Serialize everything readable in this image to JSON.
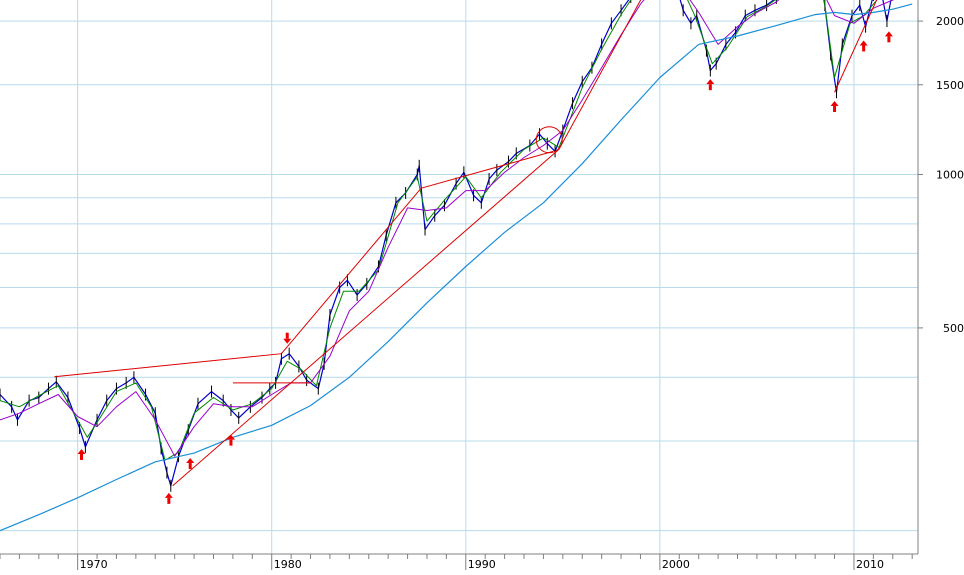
{
  "chart_data": {
    "type": "line",
    "title": "",
    "xlabel": "",
    "ylabel": "",
    "y_scale": "log",
    "ylim": [
      180,
      2200
    ],
    "xlim": [
      1966,
      2013.3
    ],
    "y_ticks": [
      {
        "value": 2000,
        "label": "2000"
      },
      {
        "value": 1500,
        "label": "1500"
      },
      {
        "value": 1000,
        "label": "1000"
      },
      {
        "value": 500,
        "label": "500"
      }
    ],
    "x_ticks": [
      {
        "value": 1970,
        "label": "1970"
      },
      {
        "value": 1980,
        "label": "1980"
      },
      {
        "value": 1990,
        "label": "1990"
      },
      {
        "value": 2000,
        "label": "2000"
      },
      {
        "value": 2010,
        "label": "2010"
      }
    ],
    "grid": true,
    "colors": {
      "price": "#0000cc",
      "fast_ma": "#008800",
      "mid_ma": "#9900cc",
      "slow_ma": "#1a8fd8",
      "trendline": "#dd0000",
      "arrow": "#ee0000",
      "grid": "#b7dcec",
      "axis": "#808080"
    },
    "series": [
      {
        "key": "price",
        "points": [
          [
            1966.0,
            370
          ],
          [
            1966.6,
            350
          ],
          [
            1966.9,
            330
          ],
          [
            1967.5,
            360
          ],
          [
            1968.0,
            365
          ],
          [
            1968.5,
            380
          ],
          [
            1968.9,
            392
          ],
          [
            1969.5,
            365
          ],
          [
            1970.1,
            318
          ],
          [
            1970.4,
            292
          ],
          [
            1971.0,
            330
          ],
          [
            1971.5,
            360
          ],
          [
            1972.0,
            380
          ],
          [
            1972.5,
            390
          ],
          [
            1972.9,
            400
          ],
          [
            1973.5,
            370
          ],
          [
            1974.0,
            340
          ],
          [
            1974.3,
            290
          ],
          [
            1974.6,
            260
          ],
          [
            1974.8,
            245
          ],
          [
            1975.2,
            280
          ],
          [
            1975.7,
            315
          ],
          [
            1976.2,
            355
          ],
          [
            1976.9,
            375
          ],
          [
            1977.5,
            360
          ],
          [
            1977.9,
            345
          ],
          [
            1978.3,
            333
          ],
          [
            1978.9,
            350
          ],
          [
            1979.5,
            365
          ],
          [
            1979.9,
            380
          ],
          [
            1980.2,
            390
          ],
          [
            1980.5,
            435
          ],
          [
            1980.9,
            445
          ],
          [
            1981.4,
            420
          ],
          [
            1981.8,
            395
          ],
          [
            1982.4,
            380
          ],
          [
            1982.7,
            425
          ],
          [
            1983.0,
            530
          ],
          [
            1983.5,
            600
          ],
          [
            1983.9,
            620
          ],
          [
            1984.4,
            580
          ],
          [
            1984.9,
            610
          ],
          [
            1985.5,
            660
          ],
          [
            1985.9,
            760
          ],
          [
            1986.4,
            880
          ],
          [
            1986.9,
            920
          ],
          [
            1987.5,
            1000
          ],
          [
            1987.6,
            1040
          ],
          [
            1987.9,
            780
          ],
          [
            1988.4,
            830
          ],
          [
            1988.9,
            870
          ],
          [
            1989.5,
            960
          ],
          [
            1989.9,
            1010
          ],
          [
            1990.4,
            910
          ],
          [
            1990.8,
            880
          ],
          [
            1991.2,
            980
          ],
          [
            1991.6,
            1020
          ],
          [
            1992.2,
            1060
          ],
          [
            1992.6,
            1100
          ],
          [
            1993.3,
            1140
          ],
          [
            1993.8,
            1200
          ],
          [
            1994.2,
            1150
          ],
          [
            1994.6,
            1110
          ],
          [
            1995.0,
            1220
          ],
          [
            1995.5,
            1380
          ],
          [
            1996.0,
            1520
          ],
          [
            1996.5,
            1620
          ],
          [
            1997.0,
            1800
          ],
          [
            1997.5,
            1980
          ],
          [
            1998.0,
            2100
          ],
          [
            1998.5,
            2230
          ],
          [
            1999.0,
            2380
          ],
          [
            1999.5,
            2550
          ],
          [
            2000.0,
            2650
          ],
          [
            2000.3,
            2680
          ],
          [
            2000.7,
            2450
          ],
          [
            2001.2,
            2100
          ],
          [
            2001.6,
            1980
          ],
          [
            2001.9,
            2050
          ],
          [
            2002.4,
            1750
          ],
          [
            2002.6,
            1600
          ],
          [
            2002.9,
            1650
          ],
          [
            2003.4,
            1800
          ],
          [
            2003.9,
            1900
          ],
          [
            2004.4,
            2050
          ],
          [
            2004.9,
            2100
          ],
          [
            2005.5,
            2150
          ],
          [
            2006.0,
            2220
          ],
          [
            2006.5,
            2300
          ],
          [
            2006.9,
            2400
          ],
          [
            2007.3,
            2580
          ],
          [
            2007.8,
            2620
          ],
          [
            2008.2,
            2480
          ],
          [
            2008.5,
            2150
          ],
          [
            2008.8,
            1720
          ],
          [
            2009.1,
            1450
          ],
          [
            2009.4,
            1800
          ],
          [
            2009.9,
            2050
          ],
          [
            2010.3,
            2150
          ],
          [
            2010.6,
            1950
          ],
          [
            2011.0,
            2250
          ],
          [
            2011.4,
            2300
          ],
          [
            2011.7,
            2000
          ],
          [
            2012.0,
            2300
          ],
          [
            2012.5,
            2400
          ],
          [
            2012.9,
            2520
          ],
          [
            2013.2,
            2500
          ]
        ]
      },
      {
        "key": "fast_ma",
        "points": [
          [
            1966.0,
            360
          ],
          [
            1967.0,
            350
          ],
          [
            1968.0,
            368
          ],
          [
            1969.0,
            385
          ],
          [
            1969.8,
            340
          ],
          [
            1970.5,
            305
          ],
          [
            1971.2,
            335
          ],
          [
            1972.0,
            375
          ],
          [
            1973.0,
            390
          ],
          [
            1973.8,
            350
          ],
          [
            1974.5,
            275
          ],
          [
            1975.2,
            285
          ],
          [
            1976.0,
            340
          ],
          [
            1977.0,
            365
          ],
          [
            1978.0,
            345
          ],
          [
            1979.0,
            355
          ],
          [
            1980.0,
            380
          ],
          [
            1980.8,
            430
          ],
          [
            1981.5,
            415
          ],
          [
            1982.3,
            385
          ],
          [
            1983.0,
            500
          ],
          [
            1983.7,
            590
          ],
          [
            1984.5,
            590
          ],
          [
            1985.5,
            650
          ],
          [
            1986.5,
            880
          ],
          [
            1987.5,
            990
          ],
          [
            1988.0,
            810
          ],
          [
            1989.0,
            900
          ],
          [
            1990.0,
            990
          ],
          [
            1990.8,
            900
          ],
          [
            1991.8,
            1010
          ],
          [
            1993.0,
            1120
          ],
          [
            1994.0,
            1180
          ],
          [
            1994.8,
            1130
          ],
          [
            1996.0,
            1480
          ],
          [
            1997.0,
            1760
          ],
          [
            1998.0,
            2060
          ],
          [
            1999.0,
            2350
          ],
          [
            2000.0,
            2620
          ],
          [
            2000.8,
            2480
          ],
          [
            2001.8,
            2050
          ],
          [
            2002.7,
            1650
          ],
          [
            2003.5,
            1780
          ],
          [
            2004.5,
            2040
          ],
          [
            2005.5,
            2140
          ],
          [
            2006.5,
            2280
          ],
          [
            2007.5,
            2560
          ],
          [
            2008.3,
            2450
          ],
          [
            2009.0,
            1550
          ],
          [
            2009.8,
            1980
          ],
          [
            2010.5,
            2050
          ],
          [
            2011.4,
            2250
          ],
          [
            2012.0,
            2200
          ],
          [
            2013.0,
            2450
          ]
        ]
      },
      {
        "key": "mid_ma",
        "points": [
          [
            1966.0,
            330
          ],
          [
            1967.0,
            340
          ],
          [
            1968.0,
            355
          ],
          [
            1969.0,
            370
          ],
          [
            1970.0,
            335
          ],
          [
            1971.0,
            320
          ],
          [
            1972.0,
            350
          ],
          [
            1973.0,
            375
          ],
          [
            1974.0,
            330
          ],
          [
            1975.0,
            280
          ],
          [
            1976.0,
            320
          ],
          [
            1977.0,
            355
          ],
          [
            1978.0,
            350
          ],
          [
            1979.0,
            350
          ],
          [
            1980.0,
            370
          ],
          [
            1981.0,
            390
          ],
          [
            1982.0,
            390
          ],
          [
            1983.0,
            440
          ],
          [
            1984.0,
            540
          ],
          [
            1985.0,
            590
          ],
          [
            1986.0,
            720
          ],
          [
            1987.0,
            860
          ],
          [
            1988.0,
            850
          ],
          [
            1989.0,
            860
          ],
          [
            1990.0,
            930
          ],
          [
            1991.0,
            930
          ],
          [
            1992.0,
            1010
          ],
          [
            1993.0,
            1080
          ],
          [
            1994.0,
            1140
          ],
          [
            1995.0,
            1220
          ],
          [
            1996.0,
            1400
          ],
          [
            1997.0,
            1620
          ],
          [
            1998.0,
            1880
          ],
          [
            1999.0,
            2160
          ],
          [
            2000.0,
            2400
          ],
          [
            2001.0,
            2360
          ],
          [
            2002.0,
            2080
          ],
          [
            2003.0,
            1800
          ],
          [
            2004.0,
            1950
          ],
          [
            2005.0,
            2080
          ],
          [
            2006.0,
            2180
          ],
          [
            2007.0,
            2360
          ],
          [
            2008.0,
            2450
          ],
          [
            2009.0,
            2050
          ],
          [
            2010.0,
            1980
          ],
          [
            2011.0,
            2120
          ],
          [
            2012.0,
            2200
          ],
          [
            2013.0,
            2290
          ]
        ]
      },
      {
        "key": "slow_ma",
        "points": [
          [
            1966.0,
            200
          ],
          [
            1968.0,
            215
          ],
          [
            1970.0,
            232
          ],
          [
            1972.0,
            252
          ],
          [
            1974.0,
            273
          ],
          [
            1976.0,
            284
          ],
          [
            1978.0,
            305
          ],
          [
            1980.0,
            322
          ],
          [
            1982.0,
            352
          ],
          [
            1984.0,
            400
          ],
          [
            1986.0,
            470
          ],
          [
            1988.0,
            560
          ],
          [
            1990.0,
            660
          ],
          [
            1992.0,
            770
          ],
          [
            1994.0,
            880
          ],
          [
            1996.0,
            1050
          ],
          [
            1998.0,
            1280
          ],
          [
            2000.0,
            1550
          ],
          [
            2002.0,
            1800
          ],
          [
            2004.0,
            1870
          ],
          [
            2006.0,
            1960
          ],
          [
            2008.0,
            2060
          ],
          [
            2009.0,
            2080
          ],
          [
            2010.0,
            2060
          ],
          [
            2011.0,
            2080
          ],
          [
            2012.0,
            2110
          ],
          [
            2013.0,
            2160
          ]
        ]
      }
    ],
    "trendlines": [
      [
        [
          1968.8,
          401
        ],
        [
          1980.5,
          445
        ]
      ],
      [
        [
          1980.5,
          445
        ],
        [
          1987.7,
          940
        ]
      ],
      [
        [
          1987.7,
          940
        ],
        [
          1994.5,
          1110
        ]
      ],
      [
        [
          1974.9,
          245
        ],
        [
          1994.8,
          1120
        ]
      ],
      [
        [
          1994.8,
          1120
        ],
        [
          2000.4,
          2750
        ]
      ],
      [
        [
          2000.0,
          2670
        ],
        [
          2013.0,
          2650
        ]
      ],
      [
        [
          2009.0,
          1450
        ],
        [
          2011.4,
          2300
        ]
      ],
      [
        [
          2011.4,
          2300
        ],
        [
          2013.2,
          2320
        ]
      ],
      [
        [
          1978.0,
          390
        ],
        [
          1982.0,
          390
        ]
      ]
    ],
    "circle_annotation": {
      "x": 1994.3,
      "y": 1170
    },
    "up_arrows": [
      {
        "x": 1970.2,
        "y": 300
      },
      {
        "x": 1974.7,
        "y": 246
      },
      {
        "x": 1975.8,
        "y": 288
      },
      {
        "x": 1977.9,
        "y": 320
      },
      {
        "x": 2002.6,
        "y": 1595
      },
      {
        "x": 2009.0,
        "y": 1445
      },
      {
        "x": 2010.5,
        "y": 1900
      },
      {
        "x": 2011.8,
        "y": 1980
      }
    ],
    "down_arrows": [
      {
        "x": 1980.8,
        "y": 449
      },
      {
        "x": 2012.9,
        "y": 2560
      }
    ]
  }
}
